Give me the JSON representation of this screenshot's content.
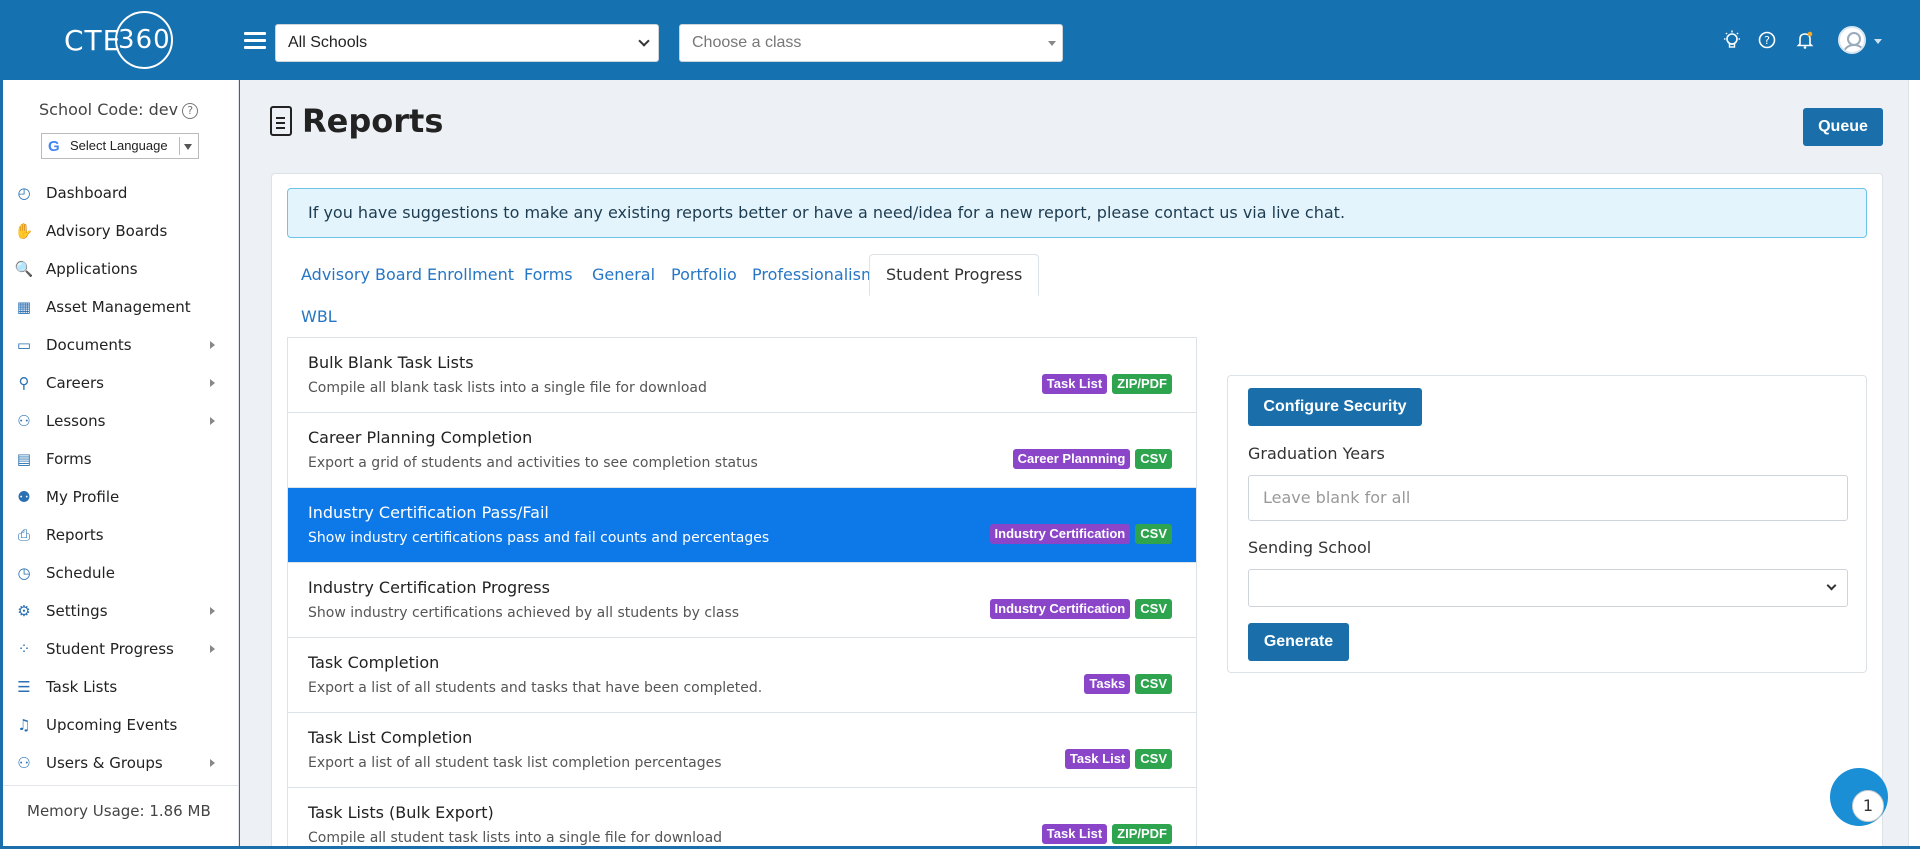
{
  "header": {
    "logo_text": "CTE",
    "logo_ring": "360",
    "school_select": "All Schools",
    "class_select_placeholder": "Choose a class",
    "icons": [
      "lightbulb-icon",
      "help-icon",
      "bell-icon",
      "user-avatar"
    ]
  },
  "sidebar": {
    "school_code": "School Code: dev",
    "language_select": "Select Language",
    "items": [
      {
        "label": "Dashboard",
        "icon": "dashboard-icon",
        "has_submenu": false
      },
      {
        "label": "Advisory Boards",
        "icon": "handshake-icon",
        "has_submenu": false
      },
      {
        "label": "Applications",
        "icon": "search-document-icon",
        "has_submenu": false
      },
      {
        "label": "Asset Management",
        "icon": "warehouse-icon",
        "has_submenu": false
      },
      {
        "label": "Documents",
        "icon": "file-icon",
        "has_submenu": true
      },
      {
        "label": "Careers",
        "icon": "person-tie-icon",
        "has_submenu": true
      },
      {
        "label": "Lessons",
        "icon": "group-icon",
        "has_submenu": true
      },
      {
        "label": "Forms",
        "icon": "form-icon",
        "has_submenu": false
      },
      {
        "label": "My Profile",
        "icon": "user-icon",
        "has_submenu": false
      },
      {
        "label": "Reports",
        "icon": "printer-icon",
        "has_submenu": false
      },
      {
        "label": "Schedule",
        "icon": "clock-icon",
        "has_submenu": false
      },
      {
        "label": "Settings",
        "icon": "gears-icon",
        "has_submenu": true
      },
      {
        "label": "Student Progress",
        "icon": "spinner-icon",
        "has_submenu": true
      },
      {
        "label": "Task Lists",
        "icon": "list-icon",
        "has_submenu": false
      },
      {
        "label": "Upcoming Events",
        "icon": "bell-icon",
        "has_submenu": false
      },
      {
        "label": "Users & Groups",
        "icon": "users-icon",
        "has_submenu": true
      }
    ],
    "memory_usage": "Memory Usage: 1.86 MB"
  },
  "page": {
    "title": "Reports",
    "queue_button": "Queue",
    "alert": "If you have suggestions to make any existing reports better or have a need/idea for a new report, please contact us via live chat.",
    "tabs": [
      "Advisory Board",
      "Enrollment",
      "Forms",
      "General",
      "Portfolio",
      "Professionalism",
      "Student Progress",
      "WBL"
    ],
    "active_tab": "Student Progress",
    "reports": [
      {
        "title": "Bulk Blank Task Lists",
        "desc": "Compile all blank task lists into a single file for download",
        "badges": [
          "Task List",
          "ZIP/PDF"
        ],
        "selected": false
      },
      {
        "title": "Career Planning Completion",
        "desc": "Export a grid of students and activities to see completion status",
        "badges": [
          "Career Plannning",
          "CSV"
        ],
        "selected": false
      },
      {
        "title": "Industry Certification Pass/Fail",
        "desc": "Show industry certifications pass and fail counts and percentages",
        "badges": [
          "Industry Certification",
          "CSV"
        ],
        "selected": true
      },
      {
        "title": "Industry Certification Progress",
        "desc": "Show industry certifications achieved by all students by class",
        "badges": [
          "Industry Certification",
          "CSV"
        ],
        "selected": false
      },
      {
        "title": "Task Completion",
        "desc": "Export a list of all students and tasks that have been completed.",
        "badges": [
          "Tasks",
          "CSV"
        ],
        "selected": false
      },
      {
        "title": "Task List Completion",
        "desc": "Export a list of all student task list completion percentages",
        "badges": [
          "Task List",
          "CSV"
        ],
        "selected": false
      },
      {
        "title": "Task Lists (Bulk Export)",
        "desc": "Compile all student task lists into a single file for download",
        "badges": [
          "Task List",
          "ZIP/PDF"
        ],
        "selected": false
      }
    ],
    "config": {
      "configure_security_button": "Configure Security",
      "graduation_years_label": "Graduation Years",
      "graduation_years_placeholder": "Leave blank for all",
      "sending_school_label": "Sending School",
      "sending_school_value": "",
      "generate_button": "Generate"
    }
  },
  "chat": {
    "count": "1"
  },
  "colors": {
    "brand": "#1671b0",
    "selected_row": "#0d78e8",
    "badge_purple": "#8a45c9",
    "badge_green": "#2ea44f",
    "tab_link": "#2776c5"
  }
}
